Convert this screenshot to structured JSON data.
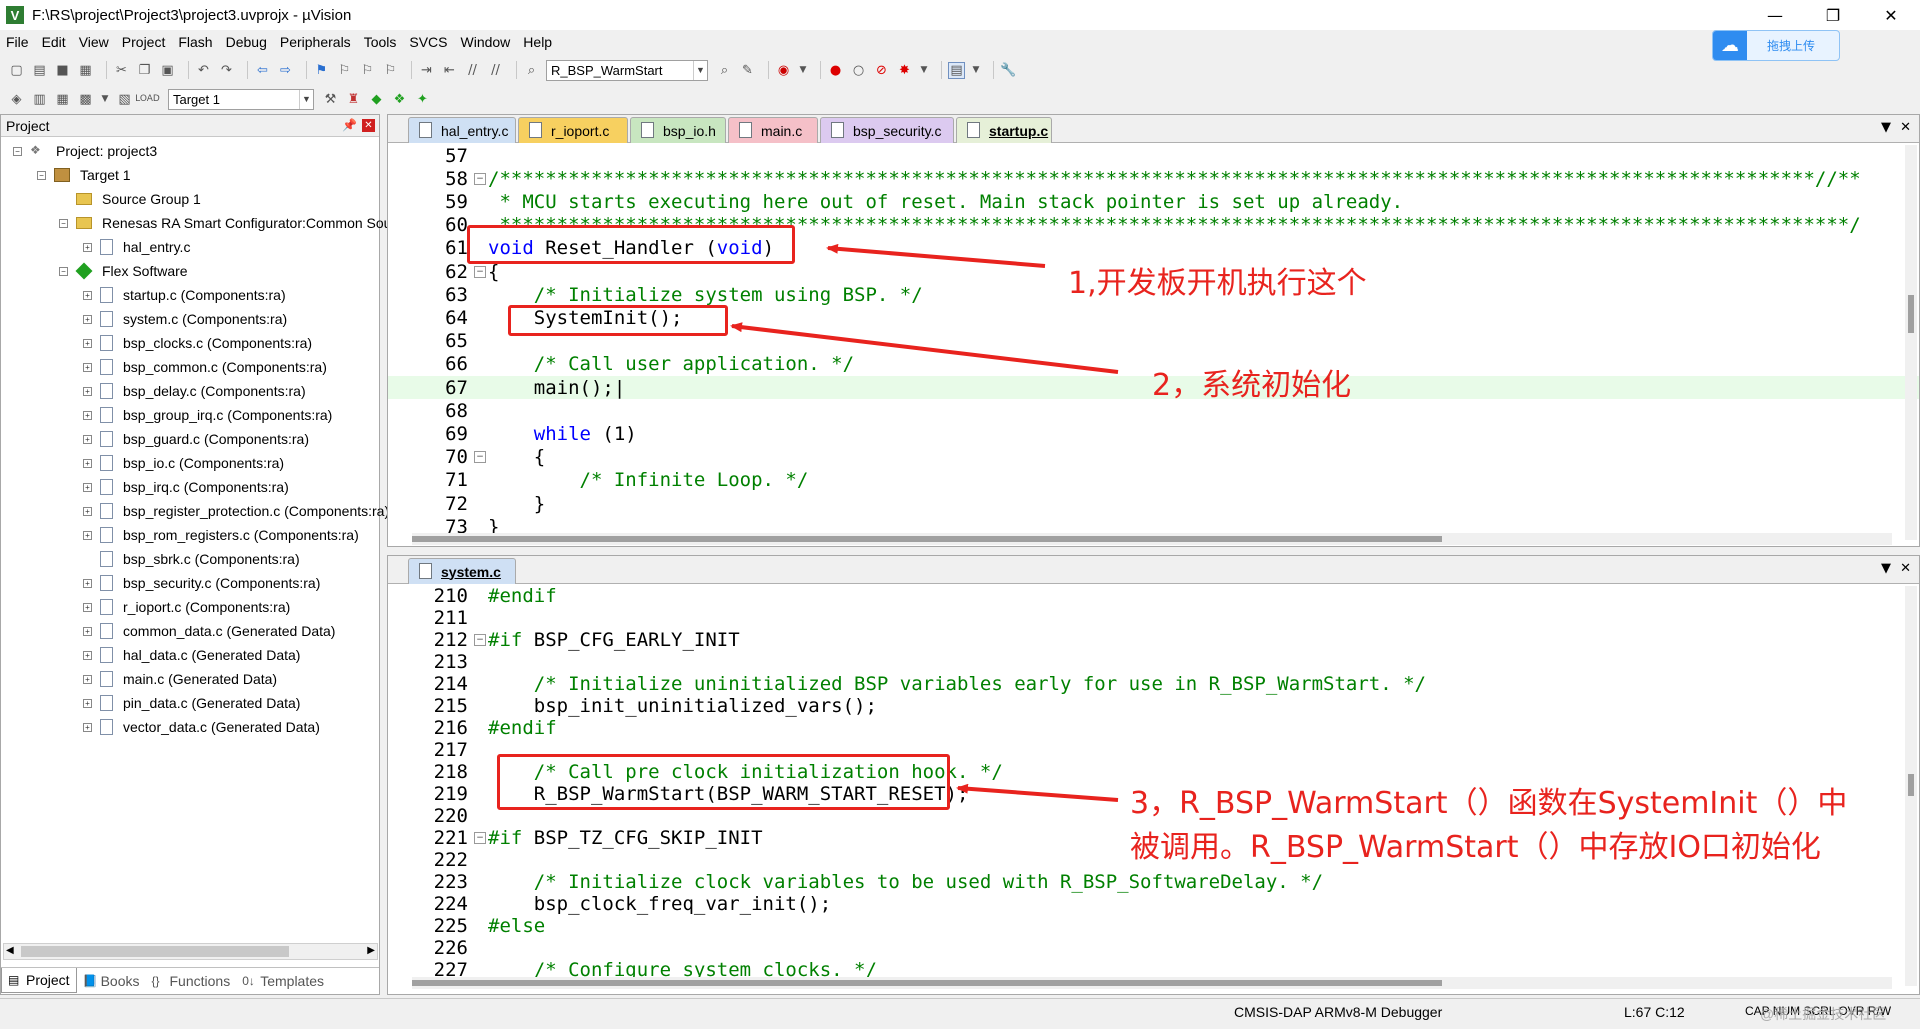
{
  "window": {
    "title": "F:\\RS\\project\\Project3\\project3.uvprojx - µVision",
    "logo": "V",
    "minimize": "—",
    "restore": "❐",
    "close": "✕"
  },
  "upload_button": {
    "label": "拖拽上传"
  },
  "menu": [
    "File",
    "Edit",
    "View",
    "Project",
    "Flash",
    "Debug",
    "Peripherals",
    "Tools",
    "SVCS",
    "Window",
    "Help"
  ],
  "toolbar": {
    "function_combo": "R_BSP_WarmStart",
    "target_combo": "Target 1"
  },
  "project_panel": {
    "title": "Project",
    "items": [
      {
        "label": "Project: project3",
        "icon": "project-icon",
        "depth": 0,
        "toggle": "−"
      },
      {
        "label": "Target 1",
        "icon": "target-icon",
        "depth": 1,
        "toggle": "−"
      },
      {
        "label": "Source Group 1",
        "icon": "folder-icon",
        "depth": 2,
        "toggle": ""
      },
      {
        "label": "Renesas RA Smart Configurator:Common Sources",
        "icon": "folder-icon",
        "depth": 2,
        "toggle": "−"
      },
      {
        "label": "hal_entry.c",
        "icon": "file-icon",
        "depth": 3,
        "toggle": "+"
      },
      {
        "label": "Flex Software",
        "icon": "diamond-icon",
        "depth": 2,
        "toggle": "−"
      },
      {
        "label": "startup.c (Components:ra)",
        "icon": "file-icon",
        "depth": 3,
        "toggle": "+"
      },
      {
        "label": "system.c (Components:ra)",
        "icon": "file-icon",
        "depth": 3,
        "toggle": "+"
      },
      {
        "label": "bsp_clocks.c (Components:ra)",
        "icon": "file-icon",
        "depth": 3,
        "toggle": "+"
      },
      {
        "label": "bsp_common.c (Components:ra)",
        "icon": "file-icon",
        "depth": 3,
        "toggle": "+"
      },
      {
        "label": "bsp_delay.c (Components:ra)",
        "icon": "file-icon",
        "depth": 3,
        "toggle": "+"
      },
      {
        "label": "bsp_group_irq.c (Components:ra)",
        "icon": "file-icon",
        "depth": 3,
        "toggle": "+"
      },
      {
        "label": "bsp_guard.c (Components:ra)",
        "icon": "file-icon",
        "depth": 3,
        "toggle": "+"
      },
      {
        "label": "bsp_io.c (Components:ra)",
        "icon": "file-icon",
        "depth": 3,
        "toggle": "+"
      },
      {
        "label": "bsp_irq.c (Components:ra)",
        "icon": "file-icon",
        "depth": 3,
        "toggle": "+"
      },
      {
        "label": "bsp_register_protection.c (Components:ra)",
        "icon": "file-icon",
        "depth": 3,
        "toggle": "+"
      },
      {
        "label": "bsp_rom_registers.c (Components:ra)",
        "icon": "file-icon",
        "depth": 3,
        "toggle": "+"
      },
      {
        "label": "bsp_sbrk.c (Components:ra)",
        "icon": "file-icon",
        "depth": 3,
        "toggle": ""
      },
      {
        "label": "bsp_security.c (Components:ra)",
        "icon": "file-icon",
        "depth": 3,
        "toggle": "+"
      },
      {
        "label": "r_ioport.c (Components:ra)",
        "icon": "file-icon",
        "depth": 3,
        "toggle": "+"
      },
      {
        "label": "common_data.c (Generated Data)",
        "icon": "file-icon",
        "depth": 3,
        "toggle": "+"
      },
      {
        "label": "hal_data.c (Generated Data)",
        "icon": "file-icon",
        "depth": 3,
        "toggle": "+"
      },
      {
        "label": "main.c (Generated Data)",
        "icon": "file-icon",
        "depth": 3,
        "toggle": "+"
      },
      {
        "label": "pin_data.c (Generated Data)",
        "icon": "file-icon",
        "depth": 3,
        "toggle": "+"
      },
      {
        "label": "vector_data.c (Generated Data)",
        "icon": "file-icon",
        "depth": 3,
        "toggle": "+"
      }
    ],
    "bottom_tabs": [
      {
        "label": "Project",
        "active": true
      },
      {
        "label": "Books",
        "active": false
      },
      {
        "label": "Functions",
        "active": false
      },
      {
        "label": "Templates",
        "active": false
      }
    ]
  },
  "editor_top": {
    "tabs": [
      {
        "label": "hal_entry.c",
        "color": "#cfe0f4",
        "active": false
      },
      {
        "label": "r_ioport.c",
        "color": "#f7d060",
        "active": false
      },
      {
        "label": "bsp_io.h",
        "color": "#c8e6c0",
        "active": false
      },
      {
        "label": "main.c",
        "color": "#f5c0c8",
        "active": false
      },
      {
        "label": "bsp_security.c",
        "color": "#dccaf0",
        "active": false
      },
      {
        "label": "startup.c",
        "color": "#e6f0d8",
        "active": true
      }
    ],
    "lines": [
      {
        "n": "57",
        "fold": "",
        "code": [
          {
            "t": "",
            "c": ""
          }
        ]
      },
      {
        "n": "58",
        "fold": "−",
        "code": [
          {
            "t": "/*******************************************************************************************************************//**",
            "c": "cm"
          }
        ]
      },
      {
        "n": "59",
        "fold": "",
        "code": [
          {
            "t": " * MCU starts executing here out of reset. Main stack pointer is set up already.",
            "c": "cm"
          }
        ]
      },
      {
        "n": "60",
        "fold": "",
        "code": [
          {
            "t": " **********************************************************************************************************************/",
            "c": "cm"
          }
        ]
      },
      {
        "n": "61",
        "fold": "",
        "code": [
          {
            "t": "void",
            "c": "kw"
          },
          {
            "t": " Reset_Handler (",
            "c": ""
          },
          {
            "t": "void",
            "c": "kw"
          },
          {
            "t": ")",
            "c": ""
          }
        ]
      },
      {
        "n": "62",
        "fold": "−",
        "code": [
          {
            "t": "{",
            "c": ""
          }
        ]
      },
      {
        "n": "63",
        "fold": "",
        "code": [
          {
            "t": "    /* Initialize system using BSP. */",
            "c": "cm"
          }
        ]
      },
      {
        "n": "64",
        "fold": "",
        "code": [
          {
            "t": "    SystemInit();",
            "c": ""
          }
        ]
      },
      {
        "n": "65",
        "fold": "",
        "code": [
          {
            "t": "",
            "c": ""
          }
        ]
      },
      {
        "n": "66",
        "fold": "",
        "code": [
          {
            "t": "    /* Call user application. */",
            "c": "cm"
          }
        ]
      },
      {
        "n": "67",
        "fold": "",
        "hl": true,
        "code": [
          {
            "t": "    main();|",
            "c": ""
          }
        ]
      },
      {
        "n": "68",
        "fold": "",
        "code": [
          {
            "t": "",
            "c": ""
          }
        ]
      },
      {
        "n": "69",
        "fold": "",
        "code": [
          {
            "t": "    ",
            "c": ""
          },
          {
            "t": "while",
            "c": "kw"
          },
          {
            "t": " (1)",
            "c": ""
          }
        ]
      },
      {
        "n": "70",
        "fold": "−",
        "code": [
          {
            "t": "    {",
            "c": ""
          }
        ]
      },
      {
        "n": "71",
        "fold": "",
        "code": [
          {
            "t": "        /* Infinite Loop. */",
            "c": "cm"
          }
        ]
      },
      {
        "n": "72",
        "fold": "",
        "code": [
          {
            "t": "    }",
            "c": ""
          }
        ]
      },
      {
        "n": "73",
        "fold": "",
        "code": [
          {
            "t": "}",
            "c": ""
          }
        ]
      }
    ]
  },
  "editor_bottom": {
    "tabs": [
      {
        "label": "system.c",
        "color": "#cfe0f4",
        "active": true
      }
    ],
    "lines": [
      {
        "n": "210",
        "fold": "",
        "code": [
          {
            "t": "#endif",
            "c": "pp"
          }
        ]
      },
      {
        "n": "211",
        "fold": "",
        "code": [
          {
            "t": "",
            "c": ""
          }
        ]
      },
      {
        "n": "212",
        "fold": "−",
        "code": [
          {
            "t": "#if",
            "c": "pp"
          },
          {
            "t": " BSP_CFG_EARLY_INIT",
            "c": ""
          }
        ]
      },
      {
        "n": "213",
        "fold": "",
        "code": [
          {
            "t": "",
            "c": ""
          }
        ]
      },
      {
        "n": "214",
        "fold": "",
        "code": [
          {
            "t": "    /* Initialize uninitialized BSP variables early for use in R_BSP_WarmStart. */",
            "c": "cm"
          }
        ]
      },
      {
        "n": "215",
        "fold": "",
        "code": [
          {
            "t": "    bsp_init_uninitialized_vars();",
            "c": ""
          }
        ]
      },
      {
        "n": "216",
        "fold": "",
        "code": [
          {
            "t": "#endif",
            "c": "pp"
          }
        ]
      },
      {
        "n": "217",
        "fold": "",
        "code": [
          {
            "t": "",
            "c": ""
          }
        ]
      },
      {
        "n": "218",
        "fold": "",
        "code": [
          {
            "t": "    /* Call pre clock initialization hook. */",
            "c": "cm"
          }
        ]
      },
      {
        "n": "219",
        "fold": "",
        "code": [
          {
            "t": "    R_BSP_WarmStart(BSP_WARM_START_RESET);",
            "c": ""
          }
        ]
      },
      {
        "n": "220",
        "fold": "",
        "code": [
          {
            "t": "",
            "c": ""
          }
        ]
      },
      {
        "n": "221",
        "fold": "−",
        "code": [
          {
            "t": "#if",
            "c": "pp"
          },
          {
            "t": " BSP_TZ_CFG_SKIP_INIT",
            "c": ""
          }
        ]
      },
      {
        "n": "222",
        "fold": "",
        "code": [
          {
            "t": "",
            "c": ""
          }
        ]
      },
      {
        "n": "223",
        "fold": "",
        "code": [
          {
            "t": "    /* Initialize clock variables to be used with R_BSP_SoftwareDelay. */",
            "c": "cm"
          }
        ]
      },
      {
        "n": "224",
        "fold": "",
        "code": [
          {
            "t": "    bsp_clock_freq_var_init();",
            "c": ""
          }
        ]
      },
      {
        "n": "225",
        "fold": "",
        "code": [
          {
            "t": "#else",
            "c": "pp"
          }
        ]
      },
      {
        "n": "226",
        "fold": "",
        "code": [
          {
            "t": "",
            "c": ""
          }
        ]
      },
      {
        "n": "227",
        "fold": "",
        "code": [
          {
            "t": "    /* Configure system clocks. */",
            "c": "cm"
          }
        ]
      }
    ]
  },
  "annotations": {
    "a1": "1,开发板开机执行这个",
    "a2": "2，系统初始化",
    "a3_line1": "3，R_BSP_WarmStart（）函数在SystemInit（）中",
    "a3_line2": "被调用。R_BSP_WarmStart（）中存放IO口初始化"
  },
  "status": {
    "debugger": "CMSIS-DAP ARMv8-M Debugger",
    "position": "L:67 C:12",
    "caps": "CAP NUM SCRL OVR R/W",
    "watermark": "@稀土掘金技术社区"
  },
  "colors": {
    "annotation_red": "#e8231e",
    "comment_green": "#008000",
    "keyword_blue": "#0000ff"
  }
}
